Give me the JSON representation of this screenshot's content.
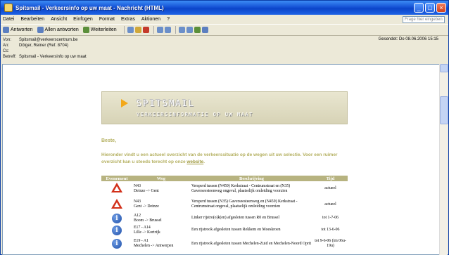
{
  "window": {
    "title": "Spitsmail - Verkeersinfo op uw maat - Nachricht (HTML)"
  },
  "menu": [
    "Datei",
    "Bearbeiten",
    "Ansicht",
    "Einfügen",
    "Format",
    "Extras",
    "Aktionen",
    "?"
  ],
  "ask_placeholder": "Frage hier eingeben",
  "toolbar": {
    "reply": "Antworten",
    "reply_all": "Allen antworten",
    "forward": "Weiterleiten"
  },
  "header": {
    "from_label": "Von:",
    "from": "Spitsmail@verkeerscentrum.be",
    "to_label": "An:",
    "to": "Dölger, Reiner (Ref. 8704)",
    "cc_label": "Cc:",
    "cc": "",
    "subject_label": "Betreff:",
    "subject": "Spitsmail - Verkeersinfo op uw maat",
    "sent": "Gesendet: Do 08.06.2006 15:15"
  },
  "mail": {
    "brand": "SPITSMAIL",
    "tagline": "VERKEERSINFORMATIE OP UW MAAT",
    "greeting": "Beste,",
    "intro": "Hieronder vindt u een actueel overzicht van de verkeerssituatie op de wegen uit uw selectie. Voor een ruimer overzicht kan u steeds terecht op onze",
    "link": "website",
    "table": {
      "headers": [
        "Evenement",
        "Weg",
        "Beschrijving",
        "Tijd"
      ],
      "rows": [
        {
          "icon": "warning-icon",
          "road1": "N43",
          "road2": "Deinze -> Gent",
          "desc": "Versperd tussen (N459) Kerkstraat - Centrumstraat en (N35) Gaverseesteenweg ongeval, plaatselijk omleiding voorzien",
          "period": "actueel"
        },
        {
          "icon": "warning-icon",
          "road1": "N43",
          "road2": "Gent -> Deinze",
          "desc": "Versperd tussen (N35) Gaverseesteenweg en (N459) Kerkstraat - Centrumstraat ongeval, plaatselijk omleiding voorzien",
          "period": "actueel"
        },
        {
          "icon": "info-icon",
          "road1": "A12",
          "road2": "Boom -> Brussel",
          "desc": "Linker rijstro(o)k(en) afgesloten tussen R0 en Brussel",
          "period": "tot 1-7-06"
        },
        {
          "icon": "info-icon",
          "road1": "E17 - A14",
          "road2": "Lille -> Kortrijk",
          "desc": "Een rijstrook afgesloten tussen Rekkem en Moeskroen",
          "period": "tot 13-6-06"
        },
        {
          "icon": "info-icon",
          "road1": "E19 - A1",
          "road2": "Mechelen -> Antwerpen",
          "desc": "Een rijstrook afgesloten tussen Mechelen-Zuid en Mechelen-Noord Oprit",
          "period": "tot 9-6-06 (tm 06u-19u)"
        }
      ]
    }
  }
}
